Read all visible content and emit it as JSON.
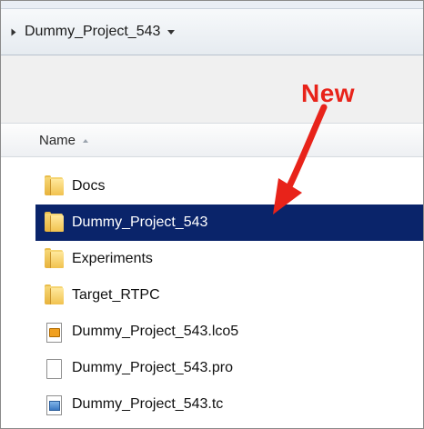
{
  "breadcrumb": {
    "folder": "Dummy_Project_543"
  },
  "annotation": {
    "text": "New",
    "color": "#e8231a"
  },
  "columns": {
    "name": "Name"
  },
  "files": [
    {
      "name": "Docs",
      "type": "folder",
      "selected": false
    },
    {
      "name": "Dummy_Project_543",
      "type": "folder",
      "selected": true
    },
    {
      "name": "Experiments",
      "type": "folder",
      "selected": false
    },
    {
      "name": "Target_RTPC",
      "type": "folder",
      "selected": false
    },
    {
      "name": "Dummy_Project_543.lco5",
      "type": "lco-file",
      "selected": false
    },
    {
      "name": "Dummy_Project_543.pro",
      "type": "generic-file",
      "selected": false
    },
    {
      "name": "Dummy_Project_543.tc",
      "type": "tc-file",
      "selected": false
    }
  ],
  "colors": {
    "selection": "#0a246a",
    "selection_text": "#ffffff"
  }
}
